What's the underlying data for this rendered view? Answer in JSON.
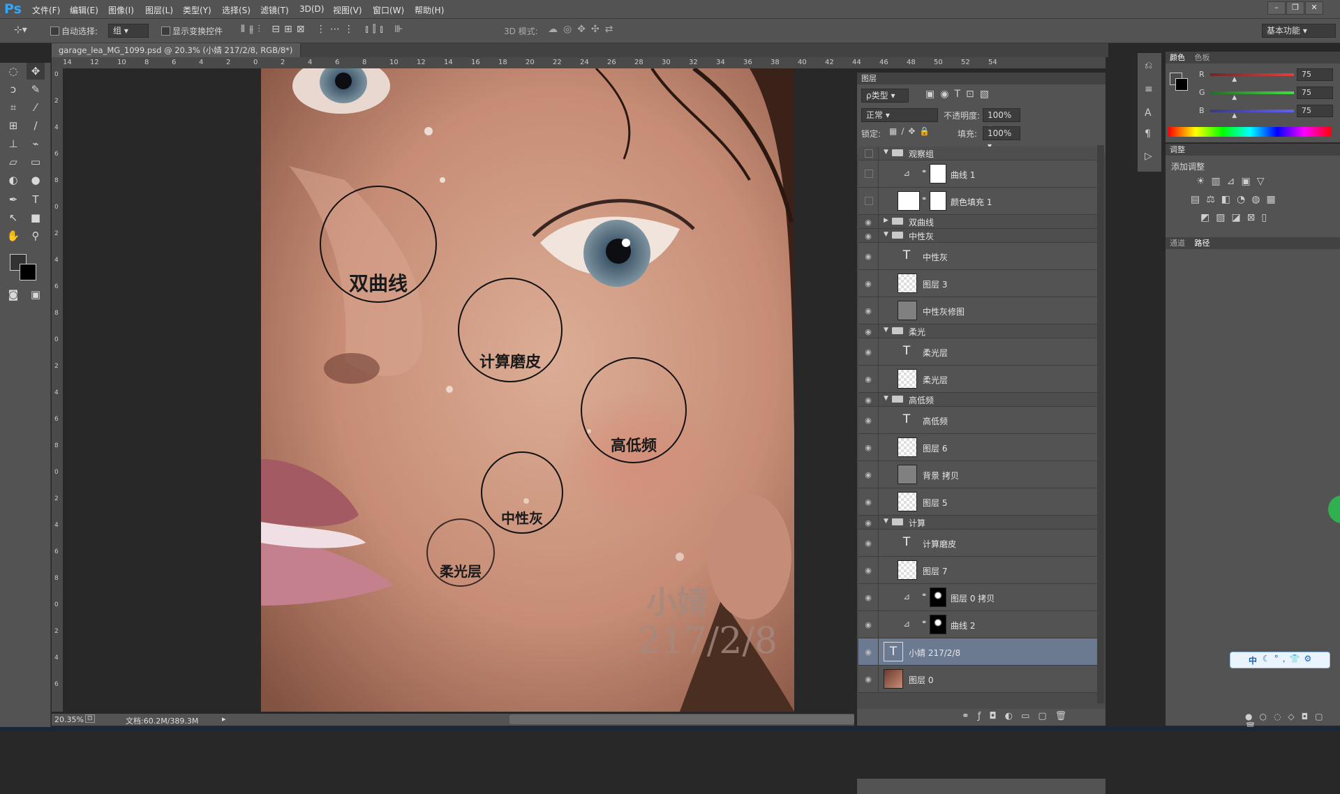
{
  "app": {
    "logo": "Ps"
  },
  "menu": [
    "文件(F)",
    "编辑(E)",
    "图像(I)",
    "图层(L)",
    "类型(Y)",
    "选择(S)",
    "滤镜(T)",
    "3D(D)",
    "视图(V)",
    "窗口(W)",
    "帮助(H)"
  ],
  "window_controls": [
    "–",
    "❐",
    "✕"
  ],
  "options": {
    "auto_select_label": "自动选择:",
    "auto_select_value": "组",
    "show_transform_label": "显示变换控件",
    "mode_3d_label": "3D 模式:",
    "workspace": "基本功能"
  },
  "document": {
    "tab_title": "garage_lea_MG_1099.psd @ 20.3% (小婧 217/2/8, RGB/8*)",
    "zoom": "20.35%",
    "doc_info": "文档:60.2M/389.3M"
  },
  "ruler_h": [
    "14",
    "12",
    "10",
    "8",
    "6",
    "4",
    "2",
    "0",
    "2",
    "4",
    "6",
    "8",
    "10",
    "12",
    "14",
    "16",
    "18",
    "20",
    "22",
    "24",
    "26",
    "28",
    "30",
    "32",
    "34",
    "36",
    "38",
    "40",
    "42",
    "44",
    "46",
    "48",
    "50",
    "52",
    "54"
  ],
  "ruler_v": [
    "0",
    "2",
    "4",
    "6",
    "8",
    "0",
    "2",
    "4",
    "6",
    "8",
    "0",
    "2",
    "4",
    "6",
    "8",
    "0",
    "2",
    "4",
    "6",
    "8",
    "0",
    "2",
    "4",
    "6"
  ],
  "canvas": {
    "circles": [
      {
        "name": "circle-shuangquxian",
        "label": "双曲线"
      },
      {
        "name": "circle-jisuan",
        "label": "计算磨皮"
      },
      {
        "name": "circle-gaodi",
        "label": "高低频"
      },
      {
        "name": "circle-zhongxing",
        "label": "中性灰"
      },
      {
        "name": "circle-rouguang",
        "label": "柔光层"
      }
    ],
    "watermark_name": "小婧",
    "watermark_date": "217/2/8"
  },
  "layers_panel": {
    "title": "图层",
    "filter_type": "ρ类型",
    "blend_mode": "正常",
    "opacity_label": "不透明度:",
    "opacity_value": "100%",
    "lock_label": "锁定:",
    "fill_label": "填充:",
    "fill_value": "100%",
    "layers": [
      {
        "name": "观察组",
        "kind": "group",
        "open": true,
        "visible": false
      },
      {
        "name": "曲线 1",
        "kind": "curves",
        "visible": false
      },
      {
        "name": "颜色填充 1",
        "kind": "fill",
        "visible": false
      },
      {
        "name": "双曲线",
        "kind": "group",
        "open": false,
        "visible": true
      },
      {
        "name": "中性灰",
        "kind": "group",
        "open": true,
        "visible": true
      },
      {
        "name": "中性灰",
        "kind": "text",
        "visible": true
      },
      {
        "name": "图层 3",
        "kind": "pixel",
        "visible": true
      },
      {
        "name": "中性灰修图",
        "kind": "gray",
        "visible": true
      },
      {
        "name": "柔光",
        "kind": "group",
        "open": true,
        "visible": true
      },
      {
        "name": "柔光层",
        "kind": "text",
        "visible": true
      },
      {
        "name": "柔光层",
        "kind": "pixel",
        "visible": true
      },
      {
        "name": "高低频",
        "kind": "group",
        "open": true,
        "visible": true
      },
      {
        "name": "高低频",
        "kind": "text",
        "visible": true
      },
      {
        "name": "图层 6",
        "kind": "pixel",
        "visible": true
      },
      {
        "name": "背景 拷贝",
        "kind": "gray",
        "visible": true
      },
      {
        "name": "图层 5",
        "kind": "pixel",
        "visible": true
      },
      {
        "name": "计算",
        "kind": "group",
        "open": true,
        "visible": true
      },
      {
        "name": "计算磨皮",
        "kind": "text",
        "visible": true
      },
      {
        "name": "图层 7",
        "kind": "pixel",
        "visible": true
      },
      {
        "name": "图层 0 拷贝",
        "kind": "mask",
        "visible": true
      },
      {
        "name": "曲线 2",
        "kind": "curves-mask",
        "visible": true
      },
      {
        "name": "小婧 217/2/8",
        "kind": "text",
        "visible": true,
        "selected": true
      },
      {
        "name": "图层 0",
        "kind": "photo",
        "visible": true
      }
    ]
  },
  "color_panel": {
    "tabs": [
      "颜色",
      "色板"
    ],
    "channels": [
      {
        "label": "R",
        "value": "75"
      },
      {
        "label": "G",
        "value": "75"
      },
      {
        "label": "B",
        "value": "75"
      }
    ]
  },
  "adjust_panel": {
    "tabs": [
      "调整"
    ],
    "subtitle": "添加调整"
  },
  "paths_panel": {
    "tabs": [
      "通道",
      "路径"
    ]
  },
  "ime": {
    "text": "中"
  }
}
